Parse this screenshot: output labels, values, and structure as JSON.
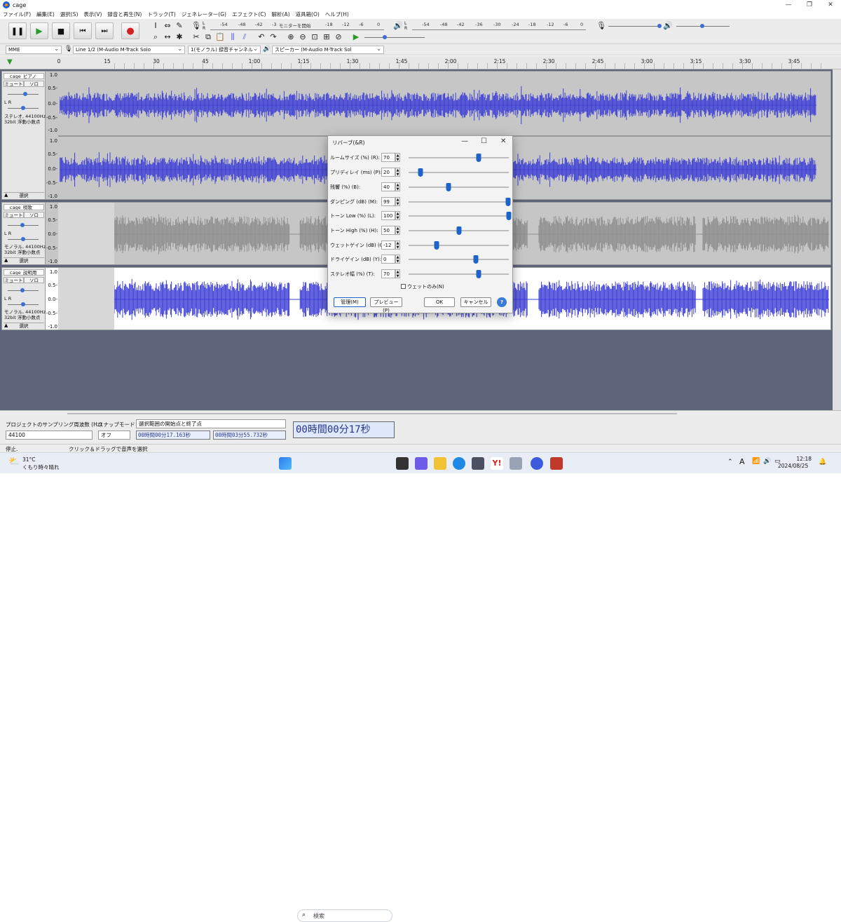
{
  "window": {
    "title": "cage",
    "minimize": "—",
    "maximize": "❐",
    "close": "✕"
  },
  "menu": [
    "ファイル(F)",
    "編集(E)",
    "選択(S)",
    "表示(V)",
    "録音と再生(N)",
    "トラック(T)",
    "ジェネレーター(G)",
    "エフェクト(C)",
    "解析(A)",
    "道具箱(O)",
    "ヘルプ(H)"
  ],
  "toolbar": {
    "record_meter_scale": [
      "-54",
      "-48",
      "-42",
      "-3",
      "モニターを開始",
      "-18",
      "-12",
      "-6",
      "0"
    ],
    "play_meter_scale": [
      "-54",
      "-48",
      "-42",
      "-36",
      "-30",
      "-24",
      "-18",
      "-12",
      "-6",
      "0"
    ],
    "meter_lr": "L\nR"
  },
  "device": {
    "host": "MME",
    "input": "Line 1/2 (M-Audio M-Track Solo",
    "channels": "1(モノラル) 録音チャンネル",
    "output": "スピーカー (M-Audio M-Track Sol"
  },
  "timeline": {
    "ticks": [
      "0",
      "15",
      "30",
      "45",
      "1:00",
      "1:15",
      "1:30",
      "1:45",
      "2:00",
      "2:15",
      "2:30",
      "2:45",
      "3:00",
      "3:15",
      "3:30",
      "3:45"
    ]
  },
  "tracks": [
    {
      "name": "cage_ピアノ",
      "mute": "ミュート",
      "solo": "ソロ",
      "lr": "L        R",
      "info1": "ステレオ, 44100Hz",
      "info2": "32bit 浮動小数点",
      "select": "選択",
      "scale": [
        "1.0",
        "0.5-",
        "0.0-",
        "-0.5-",
        "-1.0"
      ],
      "scale2": [
        "1.0",
        "0.5-",
        "0.0-",
        "-0.5-",
        "-1.0"
      ]
    },
    {
      "name": "cage_唄歌",
      "mute": "ミュート",
      "solo": "ソロ",
      "lr": "L        R",
      "info1": "モノラル, 44100Hz",
      "info2": "32bit 浮動小数点",
      "select": "選択",
      "scale": [
        "1.0",
        "0.5-",
        "0.0-",
        "-0.5-",
        "-1.0"
      ]
    },
    {
      "name": "cage_説明用",
      "mute": "ミュート",
      "solo": "ソロ",
      "lr": "L        R",
      "info1": "モノラル, 44100Hz",
      "info2": "32bit 浮動小数点",
      "select": "選択",
      "scale": [
        "1.0",
        "0.5-",
        "0.0-",
        "-0.5-",
        "-1.0"
      ]
    }
  ],
  "dialog": {
    "title": "リバーブ(&R)",
    "params": [
      {
        "label": "ルームサイズ (%) (R):",
        "value": "70",
        "fraction": 0.7
      },
      {
        "label": "プリディレイ (ms) (P):",
        "value": "20",
        "fraction": 0.12
      },
      {
        "label": "残響 (%) (B):",
        "value": "40",
        "fraction": 0.4
      },
      {
        "label": "ダンピング (dB) (M):",
        "value": "99",
        "fraction": 0.99
      },
      {
        "label": "トーン Low (%) (L):",
        "value": "100",
        "fraction": 1.0
      },
      {
        "label": "トーン High (%) (H):",
        "value": "50",
        "fraction": 0.5
      },
      {
        "label": "ウェットゲイン (dB) (G):",
        "value": "-12",
        "fraction": 0.28
      },
      {
        "label": "ドライゲイン (dB) (Y):",
        "value": "0",
        "fraction": 0.67
      },
      {
        "label": "ステレオ幅 (%) (T):",
        "value": "70",
        "fraction": 0.7
      }
    ],
    "wet_only": "ウェットのみ(N)",
    "manage": "管理(M)",
    "preview": "プレビュー(P)",
    "ok": "OK",
    "cancel": "キャンセル",
    "help": "?"
  },
  "selection": {
    "rate_label": "プロジェクトのサンプリング周波数 (Hz)",
    "rate_value": "44100",
    "snap_label": "スナップモード",
    "snap_value": "オフ",
    "range_label": "選択範囲の開始点と終了点",
    "start": "00時間00分17.163秒",
    "end": "00時間03分55.732秒",
    "big_time": "00時間00分17秒"
  },
  "status": {
    "state": "停止.",
    "hint": "クリック＆ドラッグで音声を選択"
  },
  "taskbar": {
    "weather_temp": "31°C",
    "weather_text": "くもり時々晴れ",
    "search": "検索",
    "time": "12:18",
    "date": "2024/08/25"
  },
  "colors": {
    "wave_blue": "#3d3ed6",
    "wave_grey": "#8e8e8e",
    "accent": "#1e63c8"
  }
}
